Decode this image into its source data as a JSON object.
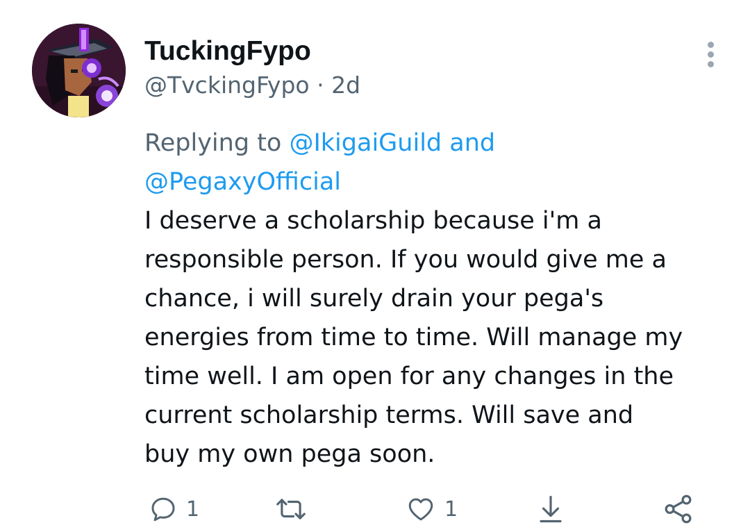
{
  "tweet": {
    "display_name": "TuckingFypo",
    "handle": "@TvckingFypo",
    "separator": "·",
    "time": "2d",
    "reply_prefix": "Replying to",
    "mention_1": "@IkigaiGuild",
    "reply_and": "and",
    "mention_2": "@PegaxyOfficial",
    "text": "I deserve a scholarship because i'm a\nresponsible person. If you would give me a\nchance, i will surely drain your pega's\nenergies from time to time. Will manage my\ntime well. I am open for any changes in the\ncurrent scholarship terms. Will save and\nbuy my own pega soon."
  },
  "actions": {
    "reply_count": "1",
    "like_count": "1"
  },
  "icons": {
    "more": "more-vertical-icon",
    "reply": "reply-bubble-icon",
    "retweet": "retweet-icon",
    "like": "heart-icon",
    "save": "download-icon",
    "share": "share-nodes-icon"
  },
  "colors": {
    "link": "#1d9bf0",
    "secondary_text": "#536471",
    "primary_text": "#0f1419",
    "icon": "#536471"
  }
}
